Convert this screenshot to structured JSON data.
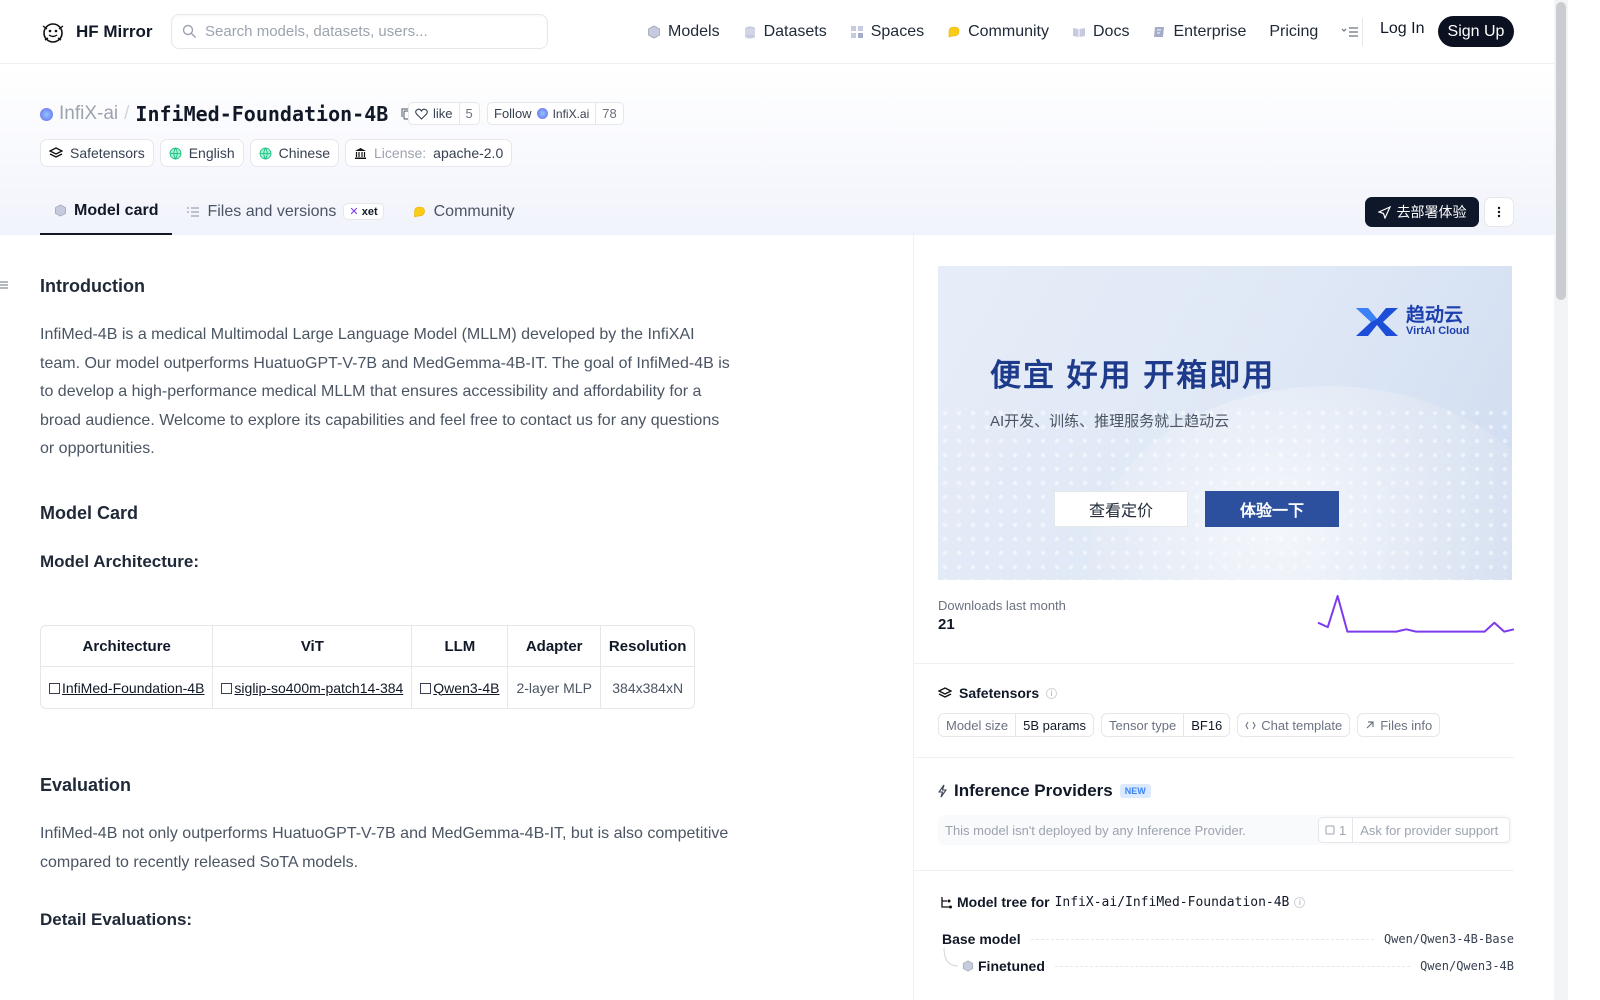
{
  "nav": {
    "logo_text": "HF Mirror",
    "search_placeholder": "Search models, datasets, users...",
    "links": [
      "Models",
      "Datasets",
      "Spaces",
      "Community",
      "Docs",
      "Enterprise",
      "Pricing"
    ],
    "login": "Log In",
    "signup": "Sign Up"
  },
  "header": {
    "org": "InfiX-ai",
    "model": "InfiMed-Foundation-4B",
    "like_label": "like",
    "like_count": "5",
    "follow_label": "Follow",
    "follow_org": "InfiX.ai",
    "follow_count": "78",
    "tags": {
      "safetensors": "Safetensors",
      "english": "English",
      "chinese": "Chinese",
      "license_label": "License:",
      "license_value": "apache-2.0"
    },
    "tabs": {
      "model_card": "Model card",
      "files": "Files and versions",
      "xet": "xet",
      "community": "Community"
    },
    "deploy_label": "去部署体验"
  },
  "content": {
    "intro_heading": "Introduction",
    "intro_text": "InfiMed-4B is a medical Multimodal Large Language Model (MLLM) developed by the InfiXAI team. Our model outperforms HuatuoGPT-V-7B and MedGemma-4B-IT. The goal of InfiMed-4B is to develop a high-performance medical MLLM that ensures accessibility and affordability for a broad audience. Welcome to explore its capabilities and feel free to contact us for any questions or opportunities.",
    "model_card_heading": "Model Card",
    "arch_heading": "Model Architecture:",
    "table": {
      "headers": [
        "Architecture",
        "ViT",
        "LLM",
        "Adapter",
        "Resolution"
      ],
      "row": [
        "InfiMed-Foundation-4B",
        "siglip-so400m-patch14-384",
        "Qwen3-4B",
        "2-layer MLP",
        "384x384xN"
      ]
    },
    "eval_heading": "Evaluation",
    "eval_text": "InfiMed-4B not only outperforms HuatuoGPT-V-7B and MedGemma-4B-IT, but is also competitive compared to recently released SoTA models.",
    "detail_heading": "Detail Evaluations:"
  },
  "sidebar": {
    "banner": {
      "brand": "趋动云",
      "brand_sub": "VirtAI Cloud",
      "headline": "便宜  好用  开箱即用",
      "subline": "AI开发、训练、推理服务就上趋动云",
      "btn_pricing": "查看定价",
      "btn_try": "体验一下"
    },
    "downloads_label": "Downloads last month",
    "downloads_count": "21",
    "downloads_trend": [
      3,
      2,
      9,
      1,
      1,
      1,
      1,
      1,
      1,
      1.5,
      1,
      1,
      1,
      1,
      1,
      1,
      1,
      1,
      3,
      1,
      1.5
    ],
    "safetensors_title": "Safetensors",
    "model_size_key": "Model size",
    "model_size_val": "5B params",
    "tensor_type_key": "Tensor type",
    "tensor_type_val": "BF16",
    "chat_template": "Chat template",
    "files_info": "Files info",
    "inference_title": "Inference Providers",
    "new_badge": "NEW",
    "inference_text": "This model isn't deployed by any Inference Provider.",
    "ask_count": "1",
    "ask_label": "Ask for provider support",
    "tree_title": "Model tree for",
    "tree_repo": "InfiX-ai/InfiMed-Foundation-4B",
    "base_model_label": "Base model",
    "base_model_value": "Qwen/Qwen3-4B-Base",
    "finetuned_label": "Finetuned",
    "finetuned_value": "Qwen/Qwen3-4B"
  },
  "colors": {
    "accent_dark": "#0b1120",
    "banner_blue": "#2c4f9e",
    "sparkline": "#7c3aed"
  }
}
